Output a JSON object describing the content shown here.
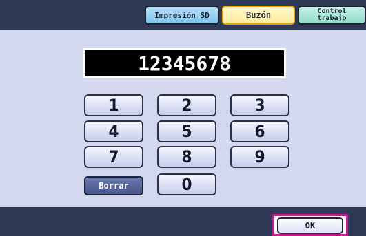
{
  "header": {
    "tabs": [
      {
        "label": "Impresión SD"
      },
      {
        "label": "Buzón"
      },
      {
        "label": "Control\ntrabajo"
      }
    ]
  },
  "display": {
    "value": "12345678"
  },
  "keypad": {
    "keys": [
      "1",
      "2",
      "3",
      "4",
      "5",
      "6",
      "7",
      "8",
      "9",
      "0"
    ],
    "clear_label": "Borrar"
  },
  "footer": {
    "ok_label": "OK"
  }
}
